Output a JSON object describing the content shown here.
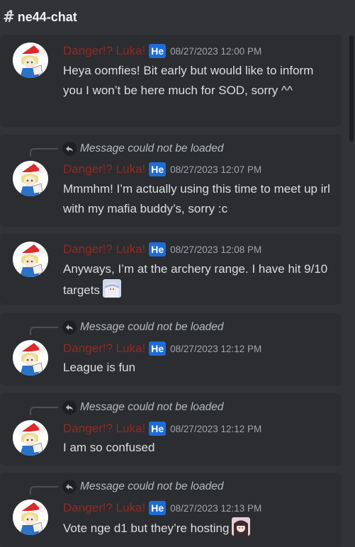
{
  "channel": {
    "name": "ne44-chat"
  },
  "messages": [
    {
      "author": "Danger!? Luka!",
      "badge": "He",
      "timestamp": "08/27/2023 12:00 PM",
      "text": "Heya oomfies! Bit early but would like to inform you I won’t be here much for SOD, sorry ^^"
    },
    {
      "reply": "Message could not be loaded",
      "author": "Danger!? Luka!",
      "badge": "He",
      "timestamp": "08/27/2023 12:07 PM",
      "text": "Mmmhm! I’m actually using this time to meet up irl with my mafia buddy’s, sorry :c"
    },
    {
      "author": "Danger!? Luka!",
      "badge": "He",
      "timestamp": "08/27/2023 12:08 PM",
      "text": "Anyways, I’m at the archery range. I have hit 9/10 targets"
    },
    {
      "reply": "Message could not be loaded",
      "author": "Danger!? Luka!",
      "badge": "He",
      "timestamp": "08/27/2023 12:12 PM",
      "text": "League is fun"
    },
    {
      "reply": "Message could not be loaded",
      "author": "Danger!? Luka!",
      "badge": "He",
      "timestamp": "08/27/2023 12:12 PM",
      "text": "I am so confused"
    },
    {
      "reply": "Message could not be loaded",
      "author": "Danger!? Luka!",
      "badge": "He",
      "timestamp": "08/27/2023 12:13 PM",
      "text": "Vote nge d1 but they’re hosting"
    }
  ],
  "colors": {
    "background": "#313338",
    "message_background": "#2b2d31",
    "author": "#8f2b24",
    "badge": "#1e6cd6"
  }
}
